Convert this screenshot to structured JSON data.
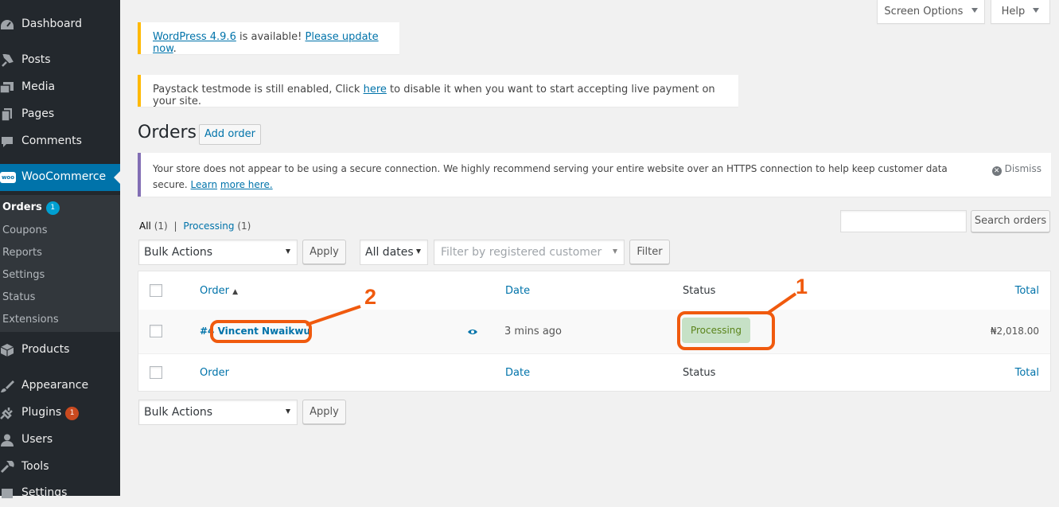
{
  "sidebar": {
    "dashboard": {
      "label": "Dashboard",
      "icon": "dashboard-icon"
    },
    "posts": {
      "label": "Posts",
      "icon": "pin-icon"
    },
    "media": {
      "label": "Media",
      "icon": "media-icon"
    },
    "pages": {
      "label": "Pages",
      "icon": "pages-icon"
    },
    "comments": {
      "label": "Comments",
      "icon": "comment-icon"
    },
    "woocommerce": {
      "label": "WooCommerce",
      "icon": "woo-icon",
      "logo_text": "woo"
    },
    "submenu": {
      "orders": {
        "label": "Orders",
        "badge": "1"
      },
      "coupons": "Coupons",
      "reports": "Reports",
      "settings": "Settings",
      "status": "Status",
      "extensions": "Extensions"
    },
    "products": {
      "label": "Products",
      "icon": "box-icon"
    },
    "appearance": {
      "label": "Appearance",
      "icon": "brush-icon"
    },
    "plugins": {
      "label": "Plugins",
      "badge": "1",
      "icon": "plug-icon"
    },
    "users": {
      "label": "Users",
      "icon": "user-icon"
    },
    "tools": {
      "label": "Tools",
      "icon": "wrench-icon"
    },
    "settings": {
      "label": "Settings",
      "icon": "settings-icon"
    }
  },
  "top": {
    "screen_options": "Screen Options",
    "help": "Help"
  },
  "notices": {
    "update": {
      "link1": "WordPress 4.9.6",
      "middle": " is available! ",
      "link2": "Please update now",
      "end": "."
    },
    "paystack": {
      "before": "Paystack testmode is still enabled, Click ",
      "link": "here",
      "after": " to disable it when you want to start accepting live payment on your site."
    },
    "https": {
      "text": "Your store does not appear to be using a secure connection. We highly recommend serving your entire website over an HTTPS connection to help keep customer data secure. ",
      "link1": "Learn",
      "link2": "more here.",
      "dismiss": "Dismiss"
    }
  },
  "page": {
    "title": "Orders",
    "add_order": "Add order"
  },
  "filters": {
    "all_label": "All",
    "all_count": "(1)",
    "separator": "|",
    "processing_label": "Processing",
    "processing_count": "(1)",
    "search_value": "",
    "search_button": "Search orders",
    "bulk_actions": "Bulk Actions",
    "apply": "Apply",
    "all_dates": "All dates",
    "customer_placeholder": "Filter by registered customer",
    "filter_button": "Filter"
  },
  "table": {
    "columns": {
      "order": "Order",
      "sort_arrow": "▲",
      "date": "Date",
      "status": "Status",
      "total": "Total"
    },
    "rows": [
      {
        "order_number": "#4",
        "customer": "Vincent Nwaikwu",
        "date": "3 mins ago",
        "status": "Processing",
        "total": "₦2,018.00"
      }
    ]
  },
  "annotations": {
    "one": "1",
    "two": "2",
    "color": "#f05a0e"
  },
  "colors": {
    "admin_blue": "#0073aa",
    "processing_bg": "#c6e1c6",
    "processing_text": "#5b841b",
    "warning": "#ffb900",
    "info": "#826eb4"
  }
}
